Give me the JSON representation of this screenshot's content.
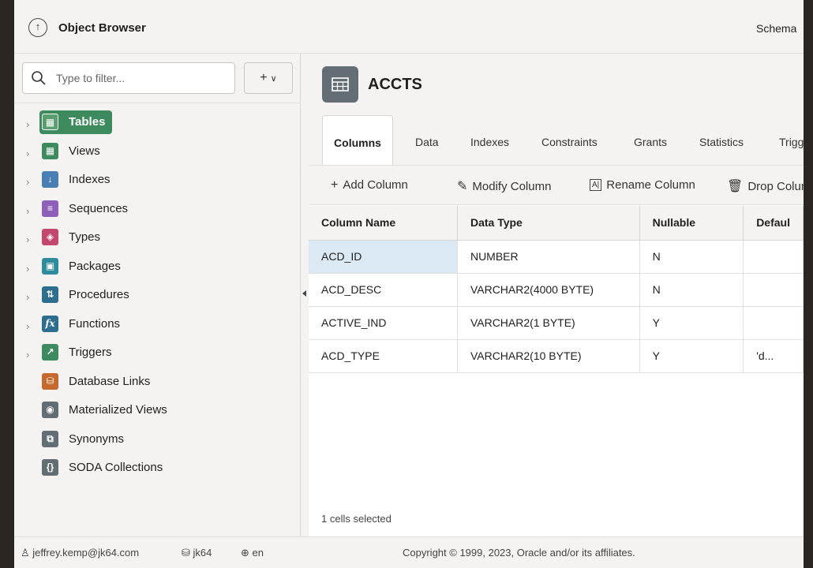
{
  "header": {
    "app_title": "Object Browser",
    "schema_label": "Schema"
  },
  "sidebar": {
    "filter_placeholder": "Type to filter...",
    "add_button": "+",
    "items": [
      {
        "label": "Tables",
        "icon": "table-icon",
        "color": "#3e8a5f",
        "expandable": true,
        "selected": true
      },
      {
        "label": "Views",
        "icon": "view-icon",
        "color": "#3e8a5f",
        "expandable": true
      },
      {
        "label": "Indexes",
        "icon": "index-icon",
        "color": "#4a7fb5",
        "expandable": true
      },
      {
        "label": "Sequences",
        "icon": "sequence-icon",
        "color": "#8d5fb8",
        "expandable": true
      },
      {
        "label": "Types",
        "icon": "cube-icon",
        "color": "#c4486d",
        "expandable": true
      },
      {
        "label": "Packages",
        "icon": "package-icon",
        "color": "#2f8c9c",
        "expandable": true
      },
      {
        "label": "Procedures",
        "icon": "procedure-icon",
        "color": "#2d6e8e",
        "expandable": true
      },
      {
        "label": "Functions",
        "icon": "function-icon",
        "color": "#2d6e8e",
        "expandable": true
      },
      {
        "label": "Triggers",
        "icon": "trigger-icon",
        "color": "#3e8a5f",
        "expandable": true
      },
      {
        "label": "Database Links",
        "icon": "database-link-icon",
        "color": "#c46a2e",
        "expandable": false
      },
      {
        "label": "Materialized Views",
        "icon": "materialized-view-icon",
        "color": "#636e74",
        "expandable": false
      },
      {
        "label": "Synonyms",
        "icon": "synonym-icon",
        "color": "#636e74",
        "expandable": false
      },
      {
        "label": "SODA Collections",
        "icon": "soda-icon",
        "color": "#636e74",
        "expandable": false
      }
    ]
  },
  "object": {
    "name": "ACCTS",
    "tabs": [
      "Columns",
      "Data",
      "Indexes",
      "Constraints",
      "Grants",
      "Statistics",
      "Trigg"
    ],
    "active_tab": "Columns"
  },
  "toolbar": {
    "add_column": "Add Column",
    "modify_column": "Modify Column",
    "rename_column": "Rename Column",
    "drop_column": "Drop Column",
    "rename_glyph": "A|"
  },
  "grid": {
    "headers": [
      "Column Name",
      "Data Type",
      "Nullable",
      "Defaul"
    ],
    "rows": [
      [
        "ACD_ID",
        "NUMBER",
        "N",
        ""
      ],
      [
        "ACD_DESC",
        "VARCHAR2(4000 BYTE)",
        "N",
        ""
      ],
      [
        "ACTIVE_IND",
        "VARCHAR2(1 BYTE)",
        "Y",
        ""
      ],
      [
        "ACD_TYPE",
        "VARCHAR2(10 BYTE)",
        "Y",
        "'d..."
      ]
    ],
    "status": "1 cells selected"
  },
  "footer": {
    "user": "jeffrey.kemp@jk64.com",
    "workspace": "jk64",
    "language": "en",
    "copyright": "Copyright © 1999, 2023, Oracle and/or its affiliates."
  }
}
